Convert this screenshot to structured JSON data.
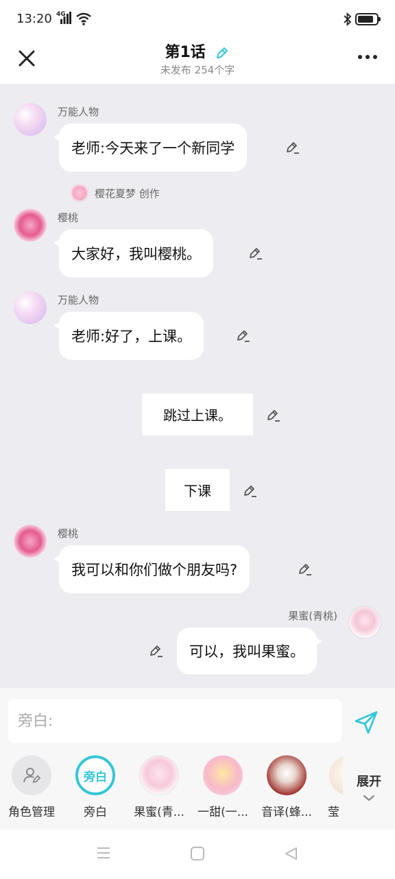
{
  "status_bar": {
    "time": "13:20",
    "network": "4G"
  },
  "header": {
    "title": "第1话",
    "subtitle": "未发布 254个字"
  },
  "chat": {
    "m1_speaker": "万能人物",
    "m1_text": "老师:今天来了一个新同学",
    "creator_text": "樱花夏梦 创作",
    "m2_speaker": "樱桃",
    "m2_text": "大家好，我叫樱桃。",
    "m3_speaker": "万能人物",
    "m3_text": "老师:好了，上课。",
    "n1_text": "跳过上课。",
    "n2_text": "下课",
    "m4_speaker": "樱桃",
    "m4_text": "我可以和你们做个朋友吗?",
    "m5_speaker": "果蜜(青桃)",
    "m5_text": "可以，我叫果蜜。"
  },
  "input": {
    "placeholder": "旁白:"
  },
  "characters": {
    "manage_label": "角色管理",
    "narration_badge": "旁白",
    "narration_label": "旁白",
    "c1_label": "果蜜(青...",
    "c2_label": "一甜(一...",
    "c3_label": "音译(蜂...",
    "c4_label": "莹"
  },
  "expand_label": "展开",
  "colors": {
    "accent": "#35c6d6",
    "chat_bg": "#ededf1"
  }
}
